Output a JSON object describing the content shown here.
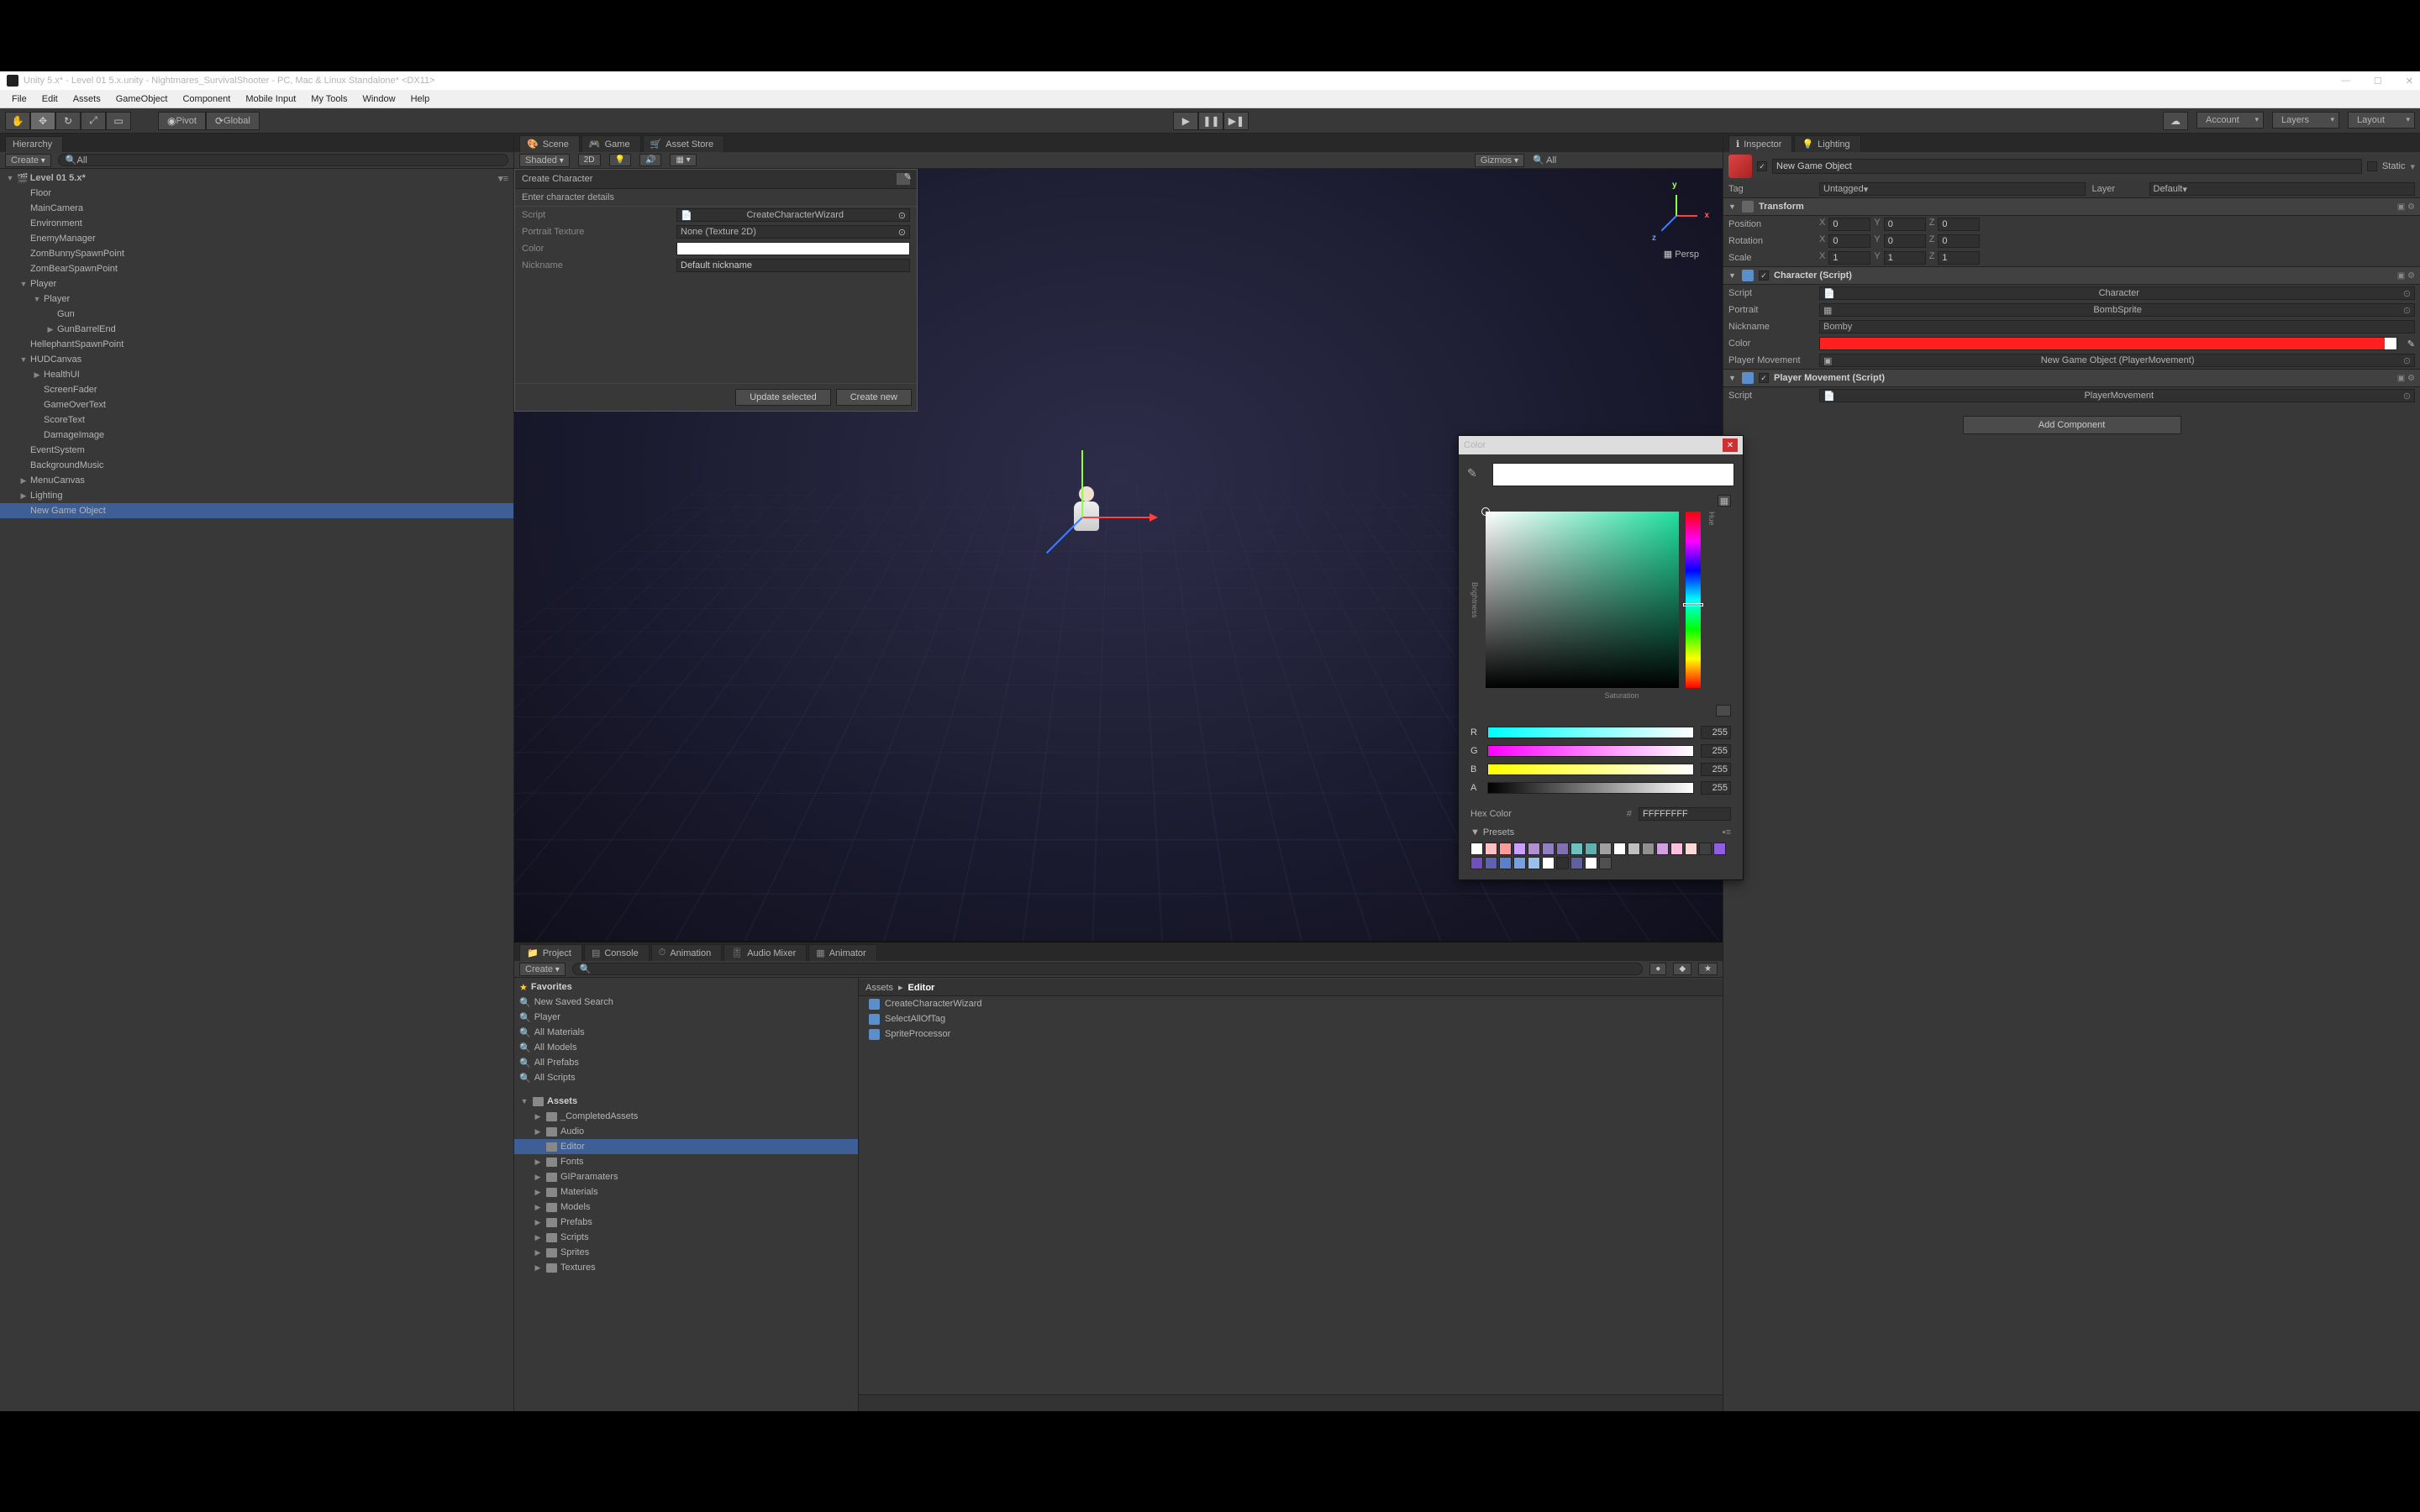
{
  "window": {
    "title": "Unity 5.x* - Level 01 5.x.unity - Nightmares_SurvivalShooter - PC, Mac & Linux Standalone* <DX11>"
  },
  "menu": [
    "File",
    "Edit",
    "Assets",
    "GameObject",
    "Component",
    "Mobile Input",
    "My Tools",
    "Window",
    "Help"
  ],
  "toolbar": {
    "pivot": "Pivot",
    "space": "Global",
    "account": "Account",
    "layers": "Layers",
    "layout": "Layout",
    "cloud_icon": "cloud"
  },
  "hierarchy": {
    "tab": "Hierarchy",
    "create": "Create",
    "search_placeholder": "All",
    "scene": "Level 01 5.x*",
    "items": [
      {
        "name": "Floor",
        "d": 1
      },
      {
        "name": "MainCamera",
        "d": 1
      },
      {
        "name": "Environment",
        "d": 1,
        "blue": true
      },
      {
        "name": "EnemyManager",
        "d": 1
      },
      {
        "name": "ZomBunnySpawnPoint",
        "d": 1
      },
      {
        "name": "ZomBearSpawnPoint",
        "d": 1
      },
      {
        "name": "Player",
        "d": 1,
        "blue": true,
        "fold": "▼"
      },
      {
        "name": "Player",
        "d": 2,
        "blue": true,
        "fold": "▼"
      },
      {
        "name": "Gun",
        "d": 3,
        "blue": true
      },
      {
        "name": "GunBarrelEnd",
        "d": 3,
        "blue": true,
        "fold": "▶"
      },
      {
        "name": "HellephantSpawnPoint",
        "d": 1
      },
      {
        "name": "HUDCanvas",
        "d": 1,
        "fold": "▼"
      },
      {
        "name": "HealthUI",
        "d": 2,
        "fold": "▶"
      },
      {
        "name": "ScreenFader",
        "d": 2
      },
      {
        "name": "GameOverText",
        "d": 2
      },
      {
        "name": "ScoreText",
        "d": 2
      },
      {
        "name": "DamageImage",
        "d": 2
      },
      {
        "name": "EventSystem",
        "d": 1
      },
      {
        "name": "BackgroundMusic",
        "d": 1
      },
      {
        "name": "MenuCanvas",
        "d": 1,
        "fold": "▶"
      },
      {
        "name": "Lighting",
        "d": 1,
        "fold": "▶"
      },
      {
        "name": "New Game Object",
        "d": 1,
        "sel": true
      }
    ]
  },
  "scene_tabs": {
    "scene": "Scene",
    "game": "Game",
    "asset_store": "Asset Store"
  },
  "scene_bar": {
    "shading": "Shaded",
    "mode2d": "2D",
    "gizmos": "Gizmos",
    "search": "All"
  },
  "scene": {
    "persp": "Persp",
    "x": "x",
    "y": "y",
    "z": "z"
  },
  "wizard": {
    "title": "Create Character",
    "subtitle": "Enter character details",
    "rows": {
      "script_lbl": "Script",
      "script_val": "CreateCharacterWizard",
      "portrait_lbl": "Portrait Texture",
      "portrait_val": "None (Texture 2D)",
      "color_lbl": "Color",
      "nick_lbl": "Nickname",
      "nick_val": "Default nickname"
    },
    "btn_update": "Update selected",
    "btn_create": "Create new"
  },
  "inspector": {
    "tabs": {
      "inspector": "Inspector",
      "lighting": "Lighting"
    },
    "obj_name": "New Game Object",
    "static": "Static",
    "tag_lbl": "Tag",
    "tag_val": "Untagged",
    "layer_lbl": "Layer",
    "layer_val": "Default",
    "transform": {
      "title": "Transform",
      "pos": "Position",
      "rot": "Rotation",
      "scale": "Scale",
      "x": "X",
      "y": "Y",
      "z": "Z",
      "px": "0",
      "py": "0",
      "pz": "0",
      "rx": "0",
      "ry": "0",
      "rz": "0",
      "sx": "1",
      "sy": "1",
      "sz": "1"
    },
    "character": {
      "title": "Character (Script)",
      "script_lbl": "Script",
      "script_val": "Character",
      "portrait_lbl": "Portrait",
      "portrait_val": "BombSprite",
      "nick_lbl": "Nickname",
      "nick_val": "Bomby",
      "color_lbl": "Color",
      "pm_lbl": "Player Movement",
      "pm_val": "New Game Object (PlayerMovement)"
    },
    "player_movement": {
      "title": "Player Movement (Script)",
      "script_lbl": "Script",
      "script_val": "PlayerMovement"
    },
    "add_component": "Add Component"
  },
  "color_picker": {
    "title": "Color",
    "brightness": "Brightness",
    "saturation": "Saturation",
    "hue": "Hue",
    "r": "R",
    "g": "G",
    "b": "B",
    "a": "A",
    "rv": "255",
    "gv": "255",
    "bv": "255",
    "av": "255",
    "hex_lbl": "Hex Color",
    "hash": "#",
    "hex": "FFFFFFFF",
    "presets_lbl": "Presets",
    "presets": [
      "#ffffff",
      "#fec0c0",
      "#ff9a9a",
      "#c9a0ff",
      "#b090d0",
      "#9080c0",
      "#8070b0",
      "#70c0c0",
      "#60b0b0",
      "#a0a0a0",
      "#ffffff",
      "#c0c0c0",
      "#909090",
      "#d0a0e0",
      "#ffc0e0",
      "#ffd8d8",
      "#404040",
      "#8f5fe0",
      "#7050c0",
      "#6060b0",
      "#5a7fd0",
      "#78a0e0",
      "#98c0f0",
      "#ffffff",
      "#303030",
      "#6060a0",
      "#ffffff",
      "#505050"
    ]
  },
  "project": {
    "tabs": [
      "Project",
      "Console",
      "Animation",
      "Audio Mixer",
      "Animator"
    ],
    "create": "Create",
    "search_placeholder": "",
    "favorites_hdr": "Favorites",
    "favorites": [
      "New Saved Search",
      "Player",
      "All Materials",
      "All Models",
      "All Prefabs",
      "All Scripts"
    ],
    "assets_hdr": "Assets",
    "folders": [
      {
        "name": "_CompletedAssets",
        "d": 1,
        "fold": "▶"
      },
      {
        "name": "Audio",
        "d": 1,
        "fold": "▶"
      },
      {
        "name": "Editor",
        "d": 1,
        "sel": true
      },
      {
        "name": "Fonts",
        "d": 1,
        "fold": "▶"
      },
      {
        "name": "GIParamaters",
        "d": 1,
        "fold": "▶"
      },
      {
        "name": "Materials",
        "d": 1,
        "fold": "▶"
      },
      {
        "name": "Models",
        "d": 1,
        "fold": "▶"
      },
      {
        "name": "Prefabs",
        "d": 1,
        "fold": "▶"
      },
      {
        "name": "Scripts",
        "d": 1,
        "fold": "▶"
      },
      {
        "name": "Sprites",
        "d": 1,
        "fold": "▶"
      },
      {
        "name": "Textures",
        "d": 1,
        "fold": "▶"
      }
    ],
    "crumb_root": "Assets",
    "crumb_sep": "▸",
    "crumb_cur": "Editor",
    "assets": [
      "CreateCharacterWizard",
      "SelectAllOfTag",
      "SpriteProcessor"
    ]
  }
}
